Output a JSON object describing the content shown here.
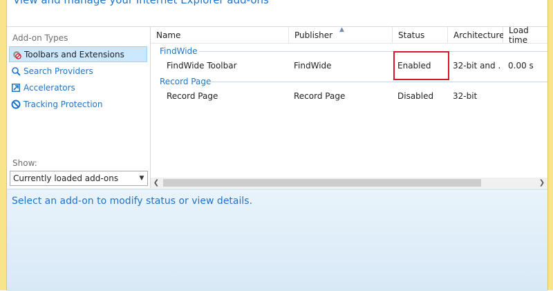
{
  "header": {
    "title": "View and manage your Internet Explorer add-ons"
  },
  "sidebar": {
    "section_label": "Add-on Types",
    "items": [
      {
        "label": "Toolbars and Extensions",
        "icon": "gear-blocked-icon",
        "selected": true
      },
      {
        "label": "Search Providers",
        "icon": "magnifier-icon",
        "selected": false
      },
      {
        "label": "Accelerators",
        "icon": "accelerator-icon",
        "selected": false
      },
      {
        "label": "Tracking Protection",
        "icon": "tracking-protection-icon",
        "selected": false
      }
    ],
    "show_label": "Show:",
    "show_select": {
      "value": "Currently loaded add-ons"
    }
  },
  "table": {
    "columns": [
      "Name",
      "Publisher",
      "Status",
      "Architecture",
      "Load time"
    ],
    "groups": [
      {
        "label": "FindWide",
        "rows": [
          {
            "name": "FindWide Toolbar",
            "publisher": "FindWide",
            "status": "Enabled",
            "architecture": "32-bit and ...",
            "load_time": "0.00 s"
          }
        ]
      },
      {
        "label": "Record Page",
        "rows": [
          {
            "name": "Record Page",
            "publisher": "Record Page",
            "status": "Disabled",
            "architecture": "32-bit",
            "load_time": ""
          }
        ]
      }
    ]
  },
  "details": {
    "message": "Select an add-on to modify status or view details."
  },
  "colors": {
    "accent": "#1e74c9",
    "highlight": "#d8152a",
    "selection": "#cce8ff"
  }
}
